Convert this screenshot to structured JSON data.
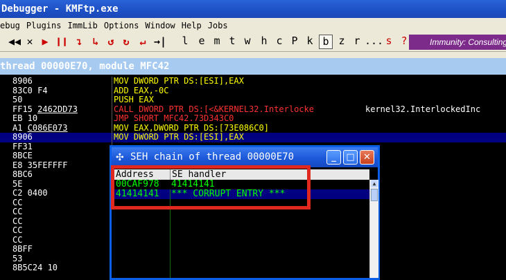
{
  "window": {
    "title": "Debugger - KMFtp.exe",
    "title_prefix": "▽"
  },
  "menu": [
    {
      "label": "ebug"
    },
    {
      "label": "Plugins"
    },
    {
      "label": "ImmLib"
    },
    {
      "label": "Options"
    },
    {
      "label": "Window"
    },
    {
      "label": "Help"
    },
    {
      "label": "Jobs"
    }
  ],
  "toolbar": {
    "icons": [
      {
        "glyph": "◀◀",
        "name": "rewind-icon",
        "color": "#000000"
      },
      {
        "glyph": "✕",
        "name": "close-icon",
        "color": "#000000"
      },
      {
        "glyph": "▶",
        "name": "run-icon",
        "color": "#cc0000"
      },
      {
        "glyph": "❙❙",
        "name": "pause-icon",
        "color": "#cc0000"
      },
      {
        "glyph": "↴",
        "name": "step-into-icon",
        "color": "#cc0000"
      },
      {
        "glyph": "↳",
        "name": "step-over-icon",
        "color": "#cc0000"
      },
      {
        "glyph": "↺",
        "name": "trace-into-icon",
        "color": "#cc0000"
      },
      {
        "glyph": "↻",
        "name": "trace-over-icon",
        "color": "#cc0000"
      },
      {
        "glyph": "↵",
        "name": "execute-till-return-icon",
        "color": "#cc0000"
      },
      {
        "glyph": "→|",
        "name": "goto-icon",
        "color": "#000000"
      }
    ],
    "letters": [
      "l",
      "e",
      "m",
      "t",
      "w",
      "h",
      "c",
      "P",
      "k",
      "b",
      "z",
      "r",
      "...",
      "s",
      "?"
    ],
    "selected_letter": "b",
    "banner": "Immunity: Consulting"
  },
  "cpu_bar": {
    "text": "thread 00000E70, module MFC42"
  },
  "code_rows": [
    {
      "hex": "8906",
      "asm": "MOV DWORD PTR DS:[ESI],EAX",
      "asm_color": "#ffff00"
    },
    {
      "hex": "83C0 F4",
      "asm": "ADD EAX,-0C",
      "asm_color": "#ffff00",
      "asm_suffix": ""
    },
    {
      "hex": "50",
      "asm": "PUSH EAX",
      "asm_color": "#ffff00"
    },
    {
      "hex": "FF15 ",
      "hex_u": "2462DD73",
      "asm": "CALL DWORD PTR DS:[<&KERNEL32.Interlocke",
      "asm_color": "#ff3030",
      "comment": "kernel32.InterlockedInc"
    },
    {
      "hex": "EB 10",
      "asm": "JMP SHORT MFC42.73D343C0",
      "asm_color": "#ff3030"
    },
    {
      "hex": "A1 ",
      "hex_u": "C086E073",
      "asm": "MOV EAX,DWORD PTR DS:[73E086C0]",
      "asm_color": "#ffff00"
    },
    {
      "hex": "8906",
      "asm": "MOV DWORD PTR DS:[ESI],EAX",
      "asm_color": "#ffff00",
      "selected": true
    },
    {
      "hex": "FF31",
      "asm": "",
      "asm_color": "#ffff00"
    },
    {
      "hex": "8BCE",
      "asm": "",
      "asm_color": "#ffff00"
    },
    {
      "hex": "E8 35FEFFFF",
      "asm": "",
      "asm_color": "#ffff00"
    },
    {
      "hex": "8BC6",
      "asm": "",
      "asm_color": "#ffff00"
    },
    {
      "hex": "5E",
      "asm": "",
      "asm_color": "#ffff00"
    },
    {
      "hex": "C2 0400",
      "asm": "",
      "asm_color": "#ffff00"
    },
    {
      "hex": "CC",
      "asm": "",
      "asm_color": "#ffff00"
    },
    {
      "hex": "CC",
      "asm": "",
      "asm_color": "#ffff00"
    },
    {
      "hex": "CC",
      "asm": "",
      "asm_color": "#ffff00"
    },
    {
      "hex": "CC",
      "asm": "",
      "asm_color": "#ffff00"
    },
    {
      "hex": "CC",
      "asm": "",
      "asm_color": "#ffff00"
    },
    {
      "hex": "8BFF",
      "asm": "",
      "asm_color": "#ffff00"
    },
    {
      "hex": "53",
      "asm": "",
      "asm_color": "#ffff00"
    },
    {
      "hex": "8B5C24 10",
      "asm": "",
      "asm_color": "#ffff00"
    }
  ],
  "seh_window": {
    "title": "SEH chain of thread 00000E70",
    "columns": [
      "Address",
      "SE handler"
    ],
    "rows": [
      {
        "address": "00CAF978",
        "handler": "41414141",
        "selected": false
      },
      {
        "address": "41414141",
        "handler": "*** CORRUPT ENTRY ***",
        "selected": true
      }
    ],
    "text_color": "#00ff00",
    "highlight_color": "#e0281f"
  }
}
